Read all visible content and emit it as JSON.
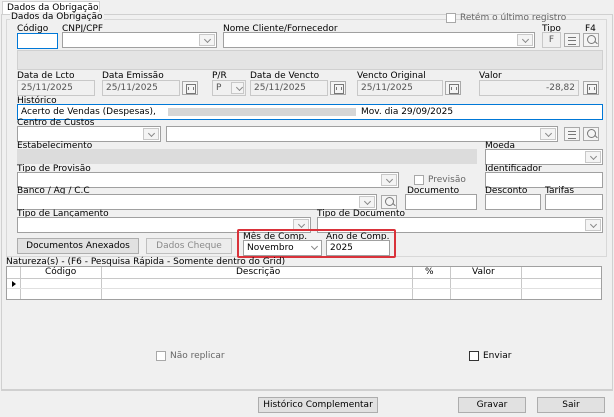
{
  "tab": {
    "label": "Dados da Obrigação"
  },
  "group": {
    "title": "Dados da Obrigação"
  },
  "retem_checkbox": {
    "label": "Retém o último registro",
    "checked": false
  },
  "labels": {
    "codigo": "Código",
    "cnpj": "CNPJ/CPF",
    "nome": "Nome Cliente/Fornecedor",
    "tipo": "Tipo",
    "f4": "F4",
    "data_lcto": "Data de Lcto",
    "data_emissao": "Data Emissão",
    "pr": "P/R",
    "data_vencto": "Data de Vencto",
    "vencto_original": "Vencto Original",
    "valor": "Valor",
    "historico": "Histórico",
    "centro_custos": "Centro de Custos",
    "estabelecimento": "Estabelecimento",
    "moeda": "Moeda",
    "tipo_provisao": "Tipo de Provisão",
    "identificador": "Identificador",
    "banco": "Banco / Ag / C.C",
    "documento": "Documento",
    "desconto": "Desconto",
    "tarifas": "Tarifas",
    "tipo_lancamento": "Tipo de Lançamento",
    "tipo_documento": "Tipo de Documento",
    "mes_comp": "Mês de Comp.",
    "ano_comp": "Ano de Comp."
  },
  "values": {
    "tipo": "F",
    "data_lcto": "25/11/2025",
    "data_emissao": "25/11/2025",
    "pr": "P",
    "data_vencto": "25/11/2025",
    "vencto_original": "25/11/2025",
    "valor": "-28,82",
    "historico_prefix": "Acerto de Vendas (Despesas),",
    "historico_suffix": "Mov. dia 29/09/2025",
    "mes_comp": "Novembro",
    "ano_comp": "2025"
  },
  "previsao_checkbox": {
    "label": "Previsão",
    "checked": false
  },
  "buttons": {
    "documentos_anexados": "Documentos Anexados",
    "dados_cheque": "Dados Cheque",
    "historico_complementar": "Histórico Complementar",
    "gravar": "Gravar",
    "sair": "Sair"
  },
  "grid": {
    "title": "Natureza(s) - (F6 - Pesquisa Rápida - Somente dentro do Grid)",
    "columns": [
      "Código",
      "Descrição",
      "%",
      "Valor"
    ]
  },
  "nao_replicar": {
    "label": "Não replicar",
    "checked": false
  },
  "enviar": {
    "label": "Enviar",
    "checked": false
  },
  "colors": {
    "highlight_border": "#d9323a",
    "focus_border": "#0078d7"
  },
  "icons": [
    "calendar-icon",
    "search-icon",
    "list-icon",
    "chevron-down-icon"
  ]
}
